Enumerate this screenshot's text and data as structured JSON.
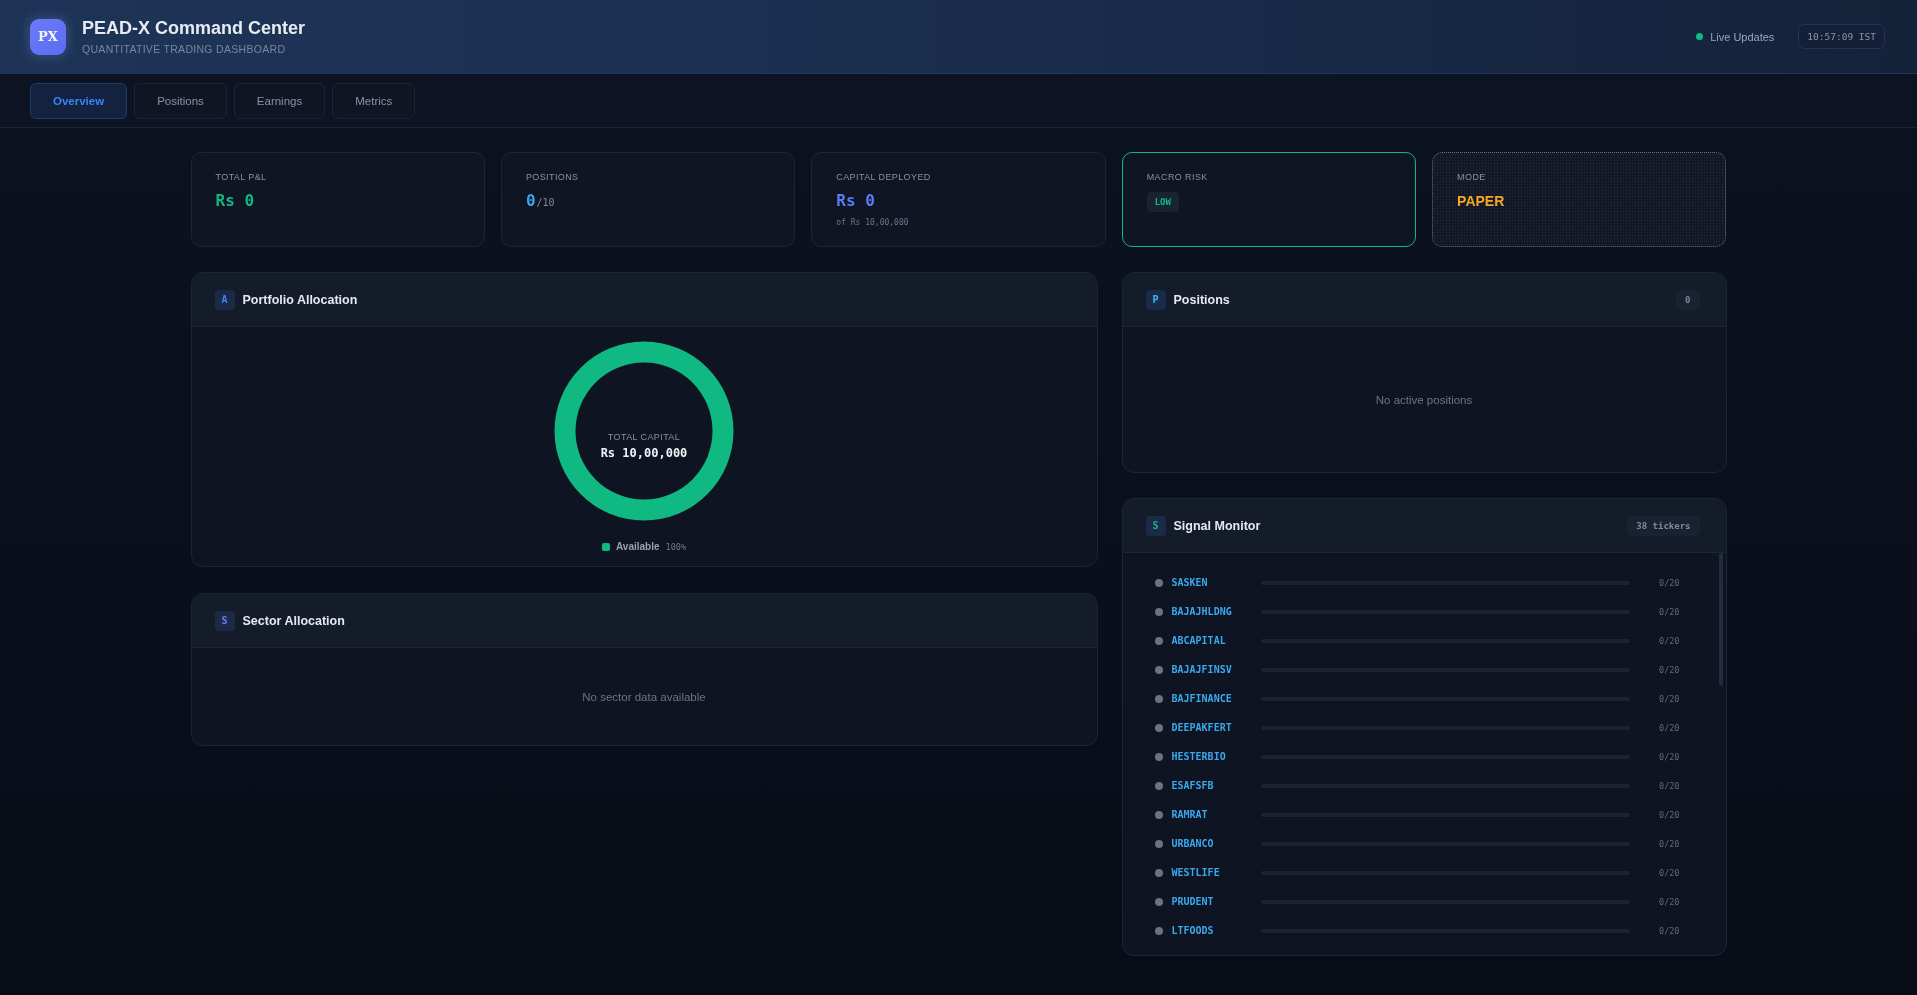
{
  "header": {
    "logo": "PX",
    "title": "PEAD-X Command Center",
    "subtitle": "QUANTITATIVE TRADING DASHBOARD",
    "live": {
      "label": "Live Updates",
      "on": true
    },
    "clock": "10:57:09 IST"
  },
  "tabs": [
    {
      "label": "Overview",
      "selected": true
    },
    {
      "label": "Positions",
      "selected": false
    },
    {
      "label": "Earnings",
      "selected": false
    },
    {
      "label": "Metrics",
      "selected": false
    }
  ],
  "stats": [
    {
      "kind": "amount",
      "label": "TOTAL P&L",
      "value": "Rs 0",
      "color": "#10b981"
    },
    {
      "kind": "fraction",
      "label": "POSITIONS",
      "value": "0",
      "suffix": "/10",
      "color": "#3aa6ee"
    },
    {
      "kind": "amount",
      "label": "CAPITAL DEPLOYED",
      "value": "Rs 0",
      "note": "of Rs 10,00,000",
      "color": "#5b7cf6"
    },
    {
      "kind": "badge",
      "label": "MACRO RISK",
      "value": "LOW",
      "color": "#10b981"
    },
    {
      "kind": "mode",
      "label": "MODE",
      "value": "PAPER",
      "color": "#f5a524"
    }
  ],
  "portfolio_allocation": {
    "letter": "A",
    "title": "Portfolio Allocation",
    "center_label": "TOTAL CAPITAL",
    "center_value": "Rs 10,00,000",
    "legend": [
      {
        "label": "Available",
        "value": "100%",
        "color": "#10b981"
      }
    ]
  },
  "sector_allocation": {
    "letter": "S",
    "title": "Sector Allocation",
    "empty_text": "No sector data available"
  },
  "positions": {
    "letter": "P",
    "title": "Positions",
    "count": "0",
    "empty_text": "No active positions"
  },
  "signal_monitor": {
    "letter": "S",
    "title": "Signal Monitor",
    "count": "38 tickers",
    "tickers": [
      {
        "symbol": "SASKEN",
        "reading": "0/20",
        "color": "#6b7280"
      },
      {
        "symbol": "BAJAJHLDNG",
        "reading": "0/20",
        "color": "#6b7280"
      },
      {
        "symbol": "ABCAPITAL",
        "reading": "0/20",
        "color": "#6b7280"
      },
      {
        "symbol": "BAJAJFINSV",
        "reading": "0/20",
        "color": "#6b7280"
      },
      {
        "symbol": "BAJFINANCE",
        "reading": "0/20",
        "color": "#6b7280"
      },
      {
        "symbol": "DEEPAKFERT",
        "reading": "0/20",
        "color": "#6b7280"
      },
      {
        "symbol": "HESTERBIO",
        "reading": "0/20",
        "color": "#6b7280"
      },
      {
        "symbol": "ESAFSFB",
        "reading": "0/20",
        "color": "#6b7280"
      },
      {
        "symbol": "RAMRAT",
        "reading": "0/20",
        "color": "#6b7280"
      },
      {
        "symbol": "URBANCO",
        "reading": "0/20",
        "color": "#6b7280"
      },
      {
        "symbol": "WESTLIFE",
        "reading": "0/20",
        "color": "#6b7280"
      },
      {
        "symbol": "PRUDENT",
        "reading": "0/20",
        "color": "#6b7280"
      },
      {
        "symbol": "LTFOODS",
        "reading": "0/20",
        "color": "#6b7280"
      }
    ]
  }
}
